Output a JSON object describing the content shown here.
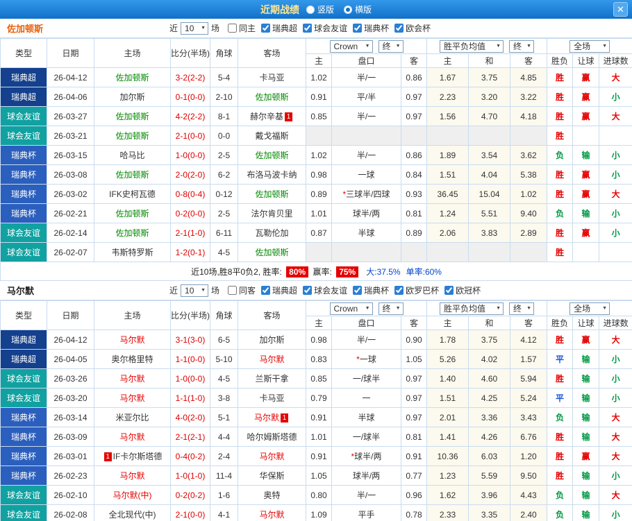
{
  "topbar": {
    "title": "近期战绩",
    "layout_options": [
      {
        "label": "竖版",
        "selected": false
      },
      {
        "label": "横版",
        "selected": true
      }
    ],
    "close_label": "✕"
  },
  "colors": {
    "type": {
      "瑞典超": "#14408e",
      "球会友谊": "#11a1a1",
      "瑞典杯": "#2b5fbe"
    },
    "team": {
      "green": "#008800",
      "red": "#e60000",
      "black": "#333333"
    },
    "outcome": {
      "胜": "#e60000",
      "平": "#1a56d8",
      "负": "#009944",
      "赢": "#e60000",
      "输": "#009944",
      "大": "#e60000",
      "小": "#009944"
    }
  },
  "table_header": {
    "main_cols": [
      "类型",
      "日期",
      "主场",
      "比分(半场)",
      "角球",
      "客场"
    ],
    "group1": {
      "select": "Crown",
      "final": "终"
    },
    "group2": {
      "select": "胜平负均值",
      "final": "终"
    },
    "group3": {
      "select": "全场"
    },
    "sub_cols": [
      "主",
      "盘口",
      "客",
      "主",
      "和",
      "客",
      "胜负",
      "让球",
      "进球数"
    ]
  },
  "sections": [
    {
      "team": "佐加顿斯",
      "team_color": "#e8610c",
      "filters": {
        "prefix": "近",
        "count": "10",
        "suffix": "场",
        "checkboxes": [
          {
            "label": "同主",
            "checked": false
          },
          {
            "label": "瑞典超",
            "checked": true
          },
          {
            "label": "球会友谊",
            "checked": true
          },
          {
            "label": "瑞典杯",
            "checked": true
          },
          {
            "label": "欧会杯",
            "checked": true
          }
        ]
      },
      "rows": [
        {
          "type": "瑞典超",
          "date": "26-04-12",
          "home": "佐加顿斯",
          "home_c": "green",
          "score": "3-2(2-2)",
          "corner": "5-4",
          "away": "卡马亚",
          "away_c": "black",
          "o": [
            "1.02",
            "半/一",
            "0.86"
          ],
          "e": [
            "1.67",
            "3.75",
            "4.85"
          ],
          "res": "胜",
          "cov": "赢",
          "big": "大"
        },
        {
          "type": "瑞典超",
          "date": "26-04-06",
          "home": "加尔斯",
          "home_c": "black",
          "score": "0-1(0-0)",
          "corner": "2-10",
          "away": "佐加顿斯",
          "away_c": "green",
          "o": [
            "0.91",
            "平/半",
            "0.97"
          ],
          "e": [
            "2.23",
            "3.20",
            "3.22"
          ],
          "res": "胜",
          "cov": "赢",
          "big": "小"
        },
        {
          "type": "球会友谊",
          "date": "26-03-27",
          "home": "佐加顿斯",
          "home_c": "green",
          "score": "4-2(2-2)",
          "corner": "8-1",
          "away": "赫尔辛基",
          "away_c": "black",
          "away_post": "1",
          "o": [
            "0.85",
            "半/一",
            "0.97"
          ],
          "e": [
            "1.56",
            "4.70",
            "4.18"
          ],
          "res": "胜",
          "cov": "赢",
          "big": "大"
        },
        {
          "type": "球会友谊",
          "date": "26-03-21",
          "home": "佐加顿斯",
          "home_c": "green",
          "score": "2-1(0-0)",
          "corner": "0-0",
          "away": "戴戈福斯",
          "away_c": "black",
          "o": [
            "",
            "",
            ""
          ],
          "e": [
            "",
            "",
            ""
          ],
          "res": "胜",
          "cov": "",
          "big": ""
        },
        {
          "type": "瑞典杯",
          "date": "26-03-15",
          "home": "哈马比",
          "home_c": "black",
          "score": "1-0(0-0)",
          "corner": "2-5",
          "away": "佐加顿斯",
          "away_c": "green",
          "o": [
            "1.02",
            "半/一",
            "0.86"
          ],
          "e": [
            "1.89",
            "3.54",
            "3.62"
          ],
          "res": "负",
          "cov": "输",
          "big": "小"
        },
        {
          "type": "瑞典杯",
          "date": "26-03-08",
          "home": "佐加顿斯",
          "home_c": "green",
          "score": "2-0(2-0)",
          "corner": "6-2",
          "away": "布洛马波卡纳",
          "away_c": "black",
          "o": [
            "0.98",
            "一球",
            "0.84"
          ],
          "e": [
            "1.51",
            "4.04",
            "5.38"
          ],
          "res": "胜",
          "cov": "赢",
          "big": "小"
        },
        {
          "type": "瑞典杯",
          "date": "26-03-02",
          "home": "IFK史柯瓦德",
          "home_c": "black",
          "score": "0-8(0-4)",
          "corner": "0-12",
          "away": "佐加顿斯",
          "away_c": "green",
          "o": [
            "0.89",
            "*三球半/四球",
            "0.93"
          ],
          "e": [
            "36.45",
            "15.04",
            "1.02"
          ],
          "res": "胜",
          "cov": "赢",
          "big": "大"
        },
        {
          "type": "瑞典杯",
          "date": "26-02-21",
          "home": "佐加顿斯",
          "home_c": "green",
          "score": "0-2(0-0)",
          "corner": "2-5",
          "away": "法尔肯贝里",
          "away_c": "black",
          "o": [
            "1.01",
            "球半/两",
            "0.81"
          ],
          "e": [
            "1.24",
            "5.51",
            "9.40"
          ],
          "res": "负",
          "cov": "输",
          "big": "小"
        },
        {
          "type": "球会友谊",
          "date": "26-02-14",
          "home": "佐加顿斯",
          "home_c": "green",
          "score": "2-1(1-0)",
          "corner": "6-11",
          "away": "瓦勒伦加",
          "away_c": "black",
          "o": [
            "0.87",
            "半球",
            "0.89"
          ],
          "e": [
            "2.06",
            "3.83",
            "2.89"
          ],
          "res": "胜",
          "cov": "赢",
          "big": "小"
        },
        {
          "type": "球会友谊",
          "date": "26-02-07",
          "home": "韦斯特罗斯",
          "home_c": "black",
          "score": "1-2(0-1)",
          "corner": "4-5",
          "away": "佐加顿斯",
          "away_c": "green",
          "o": [
            "",
            "",
            ""
          ],
          "e": [
            "",
            "",
            ""
          ],
          "res": "胜",
          "cov": "",
          "big": ""
        }
      ],
      "summary": {
        "prefix": "近10场,胜8平0负2, 胜率:",
        "win_rate": "80%",
        "mid": "赢率:",
        "cover_rate": "75%",
        "big_rate": "大:37.5%",
        "single_rate": "单率:60%"
      }
    },
    {
      "team": "马尔默",
      "team_color": "#222222",
      "filters": {
        "prefix": "近",
        "count": "10",
        "suffix": "场",
        "checkboxes": [
          {
            "label": "同客",
            "checked": false
          },
          {
            "label": "瑞典超",
            "checked": true
          },
          {
            "label": "球会友谊",
            "checked": true
          },
          {
            "label": "瑞典杯",
            "checked": true
          },
          {
            "label": "欧罗巴杯",
            "checked": true
          },
          {
            "label": "欧冠杯",
            "checked": true
          }
        ]
      },
      "rows": [
        {
          "type": "瑞典超",
          "date": "26-04-12",
          "home": "马尔默",
          "home_c": "red",
          "score": "3-1(3-0)",
          "corner": "6-5",
          "away": "加尔斯",
          "away_c": "black",
          "o": [
            "0.98",
            "半/一",
            "0.90"
          ],
          "e": [
            "1.78",
            "3.75",
            "4.12"
          ],
          "res": "胜",
          "cov": "赢",
          "big": "大"
        },
        {
          "type": "瑞典超",
          "date": "26-04-05",
          "home": "奥尔格里特",
          "home_c": "black",
          "score": "1-1(0-0)",
          "corner": "5-10",
          "away": "马尔默",
          "away_c": "red",
          "o": [
            "0.83",
            "*一球",
            "1.05"
          ],
          "e": [
            "5.26",
            "4.02",
            "1.57"
          ],
          "res": "平",
          "cov": "输",
          "big": "小"
        },
        {
          "type": "球会友谊",
          "date": "26-03-26",
          "home": "马尔默",
          "home_c": "red",
          "score": "1-0(0-0)",
          "corner": "4-5",
          "away": "兰斯干拿",
          "away_c": "black",
          "o": [
            "0.85",
            "一/球半",
            "0.97"
          ],
          "e": [
            "1.40",
            "4.60",
            "5.94"
          ],
          "res": "胜",
          "cov": "输",
          "big": "小"
        },
        {
          "type": "球会友谊",
          "date": "26-03-20",
          "home": "马尔默",
          "home_c": "red",
          "score": "1-1(1-0)",
          "corner": "3-8",
          "away": "卡马亚",
          "away_c": "black",
          "o": [
            "0.79",
            "一",
            "0.97"
          ],
          "e": [
            "1.51",
            "4.25",
            "5.24"
          ],
          "res": "平",
          "cov": "输",
          "big": "小"
        },
        {
          "type": "瑞典杯",
          "date": "26-03-14",
          "home": "米亚尔比",
          "home_c": "black",
          "score": "4-0(2-0)",
          "corner": "5-1",
          "away": "马尔默",
          "away_c": "red",
          "away_post": "1",
          "o": [
            "0.91",
            "半球",
            "0.97"
          ],
          "e": [
            "2.01",
            "3.36",
            "3.43"
          ],
          "res": "负",
          "cov": "输",
          "big": "大"
        },
        {
          "type": "瑞典杯",
          "date": "26-03-09",
          "home": "马尔默",
          "home_c": "red",
          "score": "2-1(2-1)",
          "corner": "4-4",
          "away": "哈尔姆斯塔德",
          "away_c": "black",
          "o": [
            "1.01",
            "一/球半",
            "0.81"
          ],
          "e": [
            "1.41",
            "4.26",
            "6.76"
          ],
          "res": "胜",
          "cov": "输",
          "big": "大"
        },
        {
          "type": "瑞典杯",
          "date": "26-03-01",
          "home": "IF卡尔斯塔德",
          "home_c": "black",
          "home_pre": "1",
          "score": "0-4(0-2)",
          "corner": "2-4",
          "away": "马尔默",
          "away_c": "red",
          "o": [
            "0.91",
            "*球半/两",
            "0.91"
          ],
          "e": [
            "10.36",
            "6.03",
            "1.20"
          ],
          "res": "胜",
          "cov": "赢",
          "big": "大"
        },
        {
          "type": "瑞典杯",
          "date": "26-02-23",
          "home": "马尔默",
          "home_c": "red",
          "score": "1-0(1-0)",
          "corner": "11-4",
          "away": "华保斯",
          "away_c": "black",
          "o": [
            "1.05",
            "球半/两",
            "0.77"
          ],
          "e": [
            "1.23",
            "5.59",
            "9.50"
          ],
          "res": "胜",
          "cov": "输",
          "big": "小"
        },
        {
          "type": "球会友谊",
          "date": "26-02-10",
          "home": "马尔默(中)",
          "home_c": "red",
          "score": "0-2(0-2)",
          "corner": "1-6",
          "away": "奥特",
          "away_c": "black",
          "o": [
            "0.80",
            "半/一",
            "0.96"
          ],
          "e": [
            "1.62",
            "3.96",
            "4.43"
          ],
          "res": "负",
          "cov": "输",
          "big": "大"
        },
        {
          "type": "球会友谊",
          "date": "26-02-08",
          "home": "全北现代(中)",
          "home_c": "black",
          "score": "2-1(0-0)",
          "corner": "4-1",
          "away": "马尔默",
          "away_c": "red",
          "o": [
            "1.09",
            "平手",
            "0.78"
          ],
          "e": [
            "2.33",
            "3.35",
            "2.40"
          ],
          "res": "负",
          "cov": "输",
          "big": "小"
        }
      ],
      "summary": null
    }
  ]
}
